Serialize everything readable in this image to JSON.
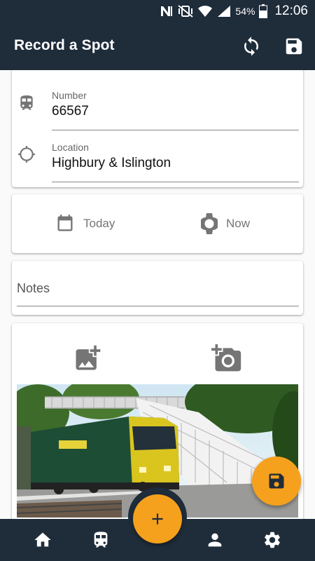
{
  "status_bar": {
    "battery": "54%",
    "time": "12:06",
    "icons": [
      "nfc-icon",
      "vibrate-mute-icon",
      "wifi-icon",
      "signal-icon",
      "battery-icon"
    ]
  },
  "app_bar": {
    "title": "Record a Spot",
    "actions": [
      "sync-icon",
      "save-icon"
    ]
  },
  "form": {
    "number": {
      "label": "Number",
      "value": "66567",
      "icon": "train-icon"
    },
    "location": {
      "label": "Location",
      "value": "Highbury & Islington",
      "icon": "gps-icon"
    },
    "date": {
      "label": "Today",
      "icon": "calendar-icon"
    },
    "time": {
      "label": "Now",
      "icon": "watch-icon"
    },
    "notes": {
      "placeholder": "Notes"
    },
    "photos": {
      "actions": [
        "add-photo-icon",
        "camera-add-icon"
      ]
    }
  },
  "bottom_nav": {
    "items": [
      "home-icon",
      "train-icon",
      "add-icon",
      "person-icon",
      "settings-icon"
    ]
  },
  "colors": {
    "primary": "#1f2c3a",
    "accent": "#f5a11d",
    "icon_grey": "#757575"
  }
}
